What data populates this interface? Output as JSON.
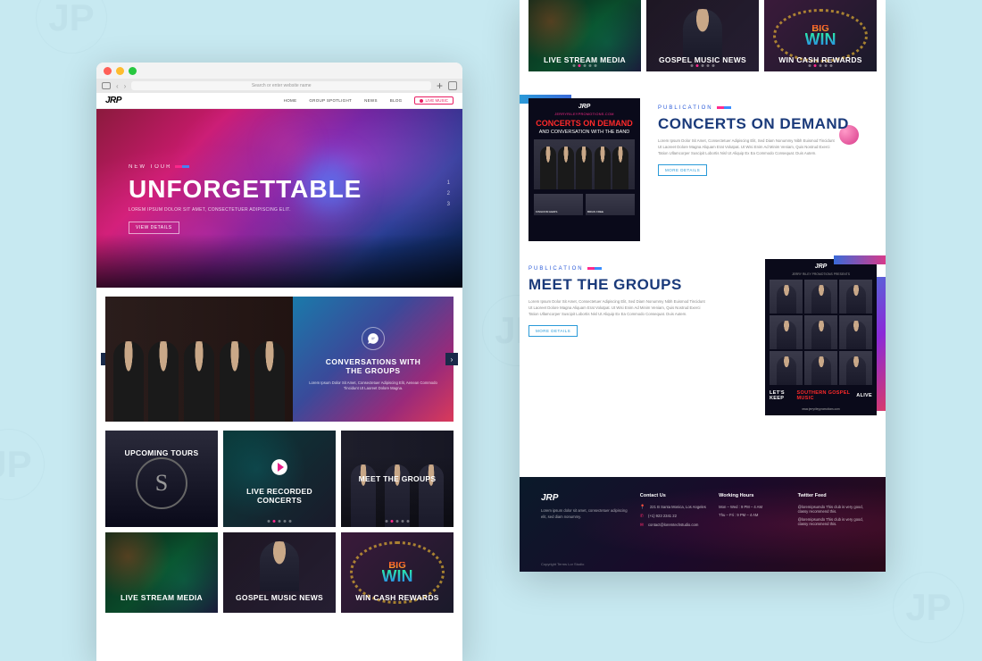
{
  "browser": {
    "search_placeholder": "Search or enter website name"
  },
  "nav": {
    "logo": "JRP",
    "items": [
      "HOME",
      "GROUP SPOTLIGHT",
      "NEWS",
      "BLOG"
    ],
    "cta": "LIVE MUSIC"
  },
  "hero": {
    "tag": "NEW TOUR",
    "title": "UNFORGETTABLE",
    "sub": "LOREM IPSUM DOLOR SIT AMET, CONSECTETUER ADIPISCING ELIT.",
    "btn": "VIEW DETAILS",
    "pages": [
      "1",
      "2",
      "3"
    ]
  },
  "conv": {
    "title_l1": "CONVERSATIONS WITH",
    "title_l2": "THE GROUPS",
    "desc": "Lorem Ipsum Dolor Sit Amet, Consectetuer Adipiscing Elit, Aenean Commodo Tincidunt Ut Laoreet Dolore Magna."
  },
  "cards": [
    {
      "title": "UPCOMING TOURS"
    },
    {
      "title_l1": "LIVE RECORDED",
      "title_l2": "CONCERTS"
    },
    {
      "title": "MEET THE GROUPS"
    },
    {
      "title": "LIVE STREAM MEDIA"
    },
    {
      "title": "GOSPEL MUSIC NEWS"
    },
    {
      "title": "WIN CASH REWARDS"
    }
  ],
  "right_top": [
    {
      "title": "LIVE STREAM MEDIA"
    },
    {
      "title": "GOSPEL MUSIC NEWS"
    },
    {
      "title": "WIN CASH REWARDS"
    }
  ],
  "pub1": {
    "tag": "PUBLICATION",
    "title": "CONCERTS ON DEMAND",
    "desc": "Lorem Ipsum Dolor Sit Amet, Consectetuer Adipiscing Elit, Sed Diam Nonummy Nibh Euismod Tincidunt Ut Laoreet Dolore Magna Aliquam Erat Volutpat. Ut Wisi Enim Ad Minim Veniam, Quis Nostrud Exerci Tation Ullamcorper Suscipit Lobortis Nisl Ut Aliquip Ex Ea Commodo Consequat. Duis Autem.",
    "btn": "MORE DETAILS",
    "card": {
      "logo": "JRP",
      "url": "JERRYRILEYPROMOTIONS.COM",
      "h1": "CONCERTS ON DEMAND",
      "h2": "AND CONVERSATION WITH THE BAND",
      "thumb1": "KINGDOM HEIRS",
      "thumb2": "BRIAN FREE"
    }
  },
  "pub2": {
    "tag": "PUBLICATION",
    "title": "MEET THE GROUPS",
    "desc": "Lorem Ipsum Dolor Sit Amet, Consectetuer Adipiscing Elit, Sed Diam Nonummy Nibh Euismod Tincidunt Ut Laoreet Dolore Magna Aliquam Erat Volutpat. Ut Wisi Enim Ad Minim Veniam, Quis Nostrud Exerci Tation Ullamcorper Suscipit Lobortis Nisl Ut Aliquip Ex Ea Commodo Consequat. Duis Autem.",
    "btn": "MORE DETAILS",
    "card": {
      "logo": "JRP",
      "sub": "JERRY RILEY PROMOTIONS PRESENTS",
      "banner_l": "LET'S KEEP",
      "banner_m": "SOUTHERN GOSPEL MUSIC",
      "banner_r": "ALIVE",
      "url": "www.jerryrileypromotions.com"
    }
  },
  "footer": {
    "logo": "JRP",
    "desc": "Lorem ipsum dolor sit amet, consectetuer adipiscing elit, sed diam nonummy.",
    "contact_h": "Contact Us",
    "addr": "221 B Santa Monica, Los Angeles",
    "phone": "(+1) 923 2341 22",
    "email": "contact@loremtechstudio.com",
    "hours_h": "Working Hours",
    "hours1": "Mon – Wed : 9 PM – 4 AM",
    "hours2": "Thu – Fri : 9 PM – 4 AM",
    "twitter_h": "Twitter Feed",
    "tw1": "@loremipsumdo This club is very good, classy recommend this.",
    "tw2": "@loremipsumdo This club is very good, classy recommend this.",
    "cp": "Copyright Terms Lor Studio"
  }
}
